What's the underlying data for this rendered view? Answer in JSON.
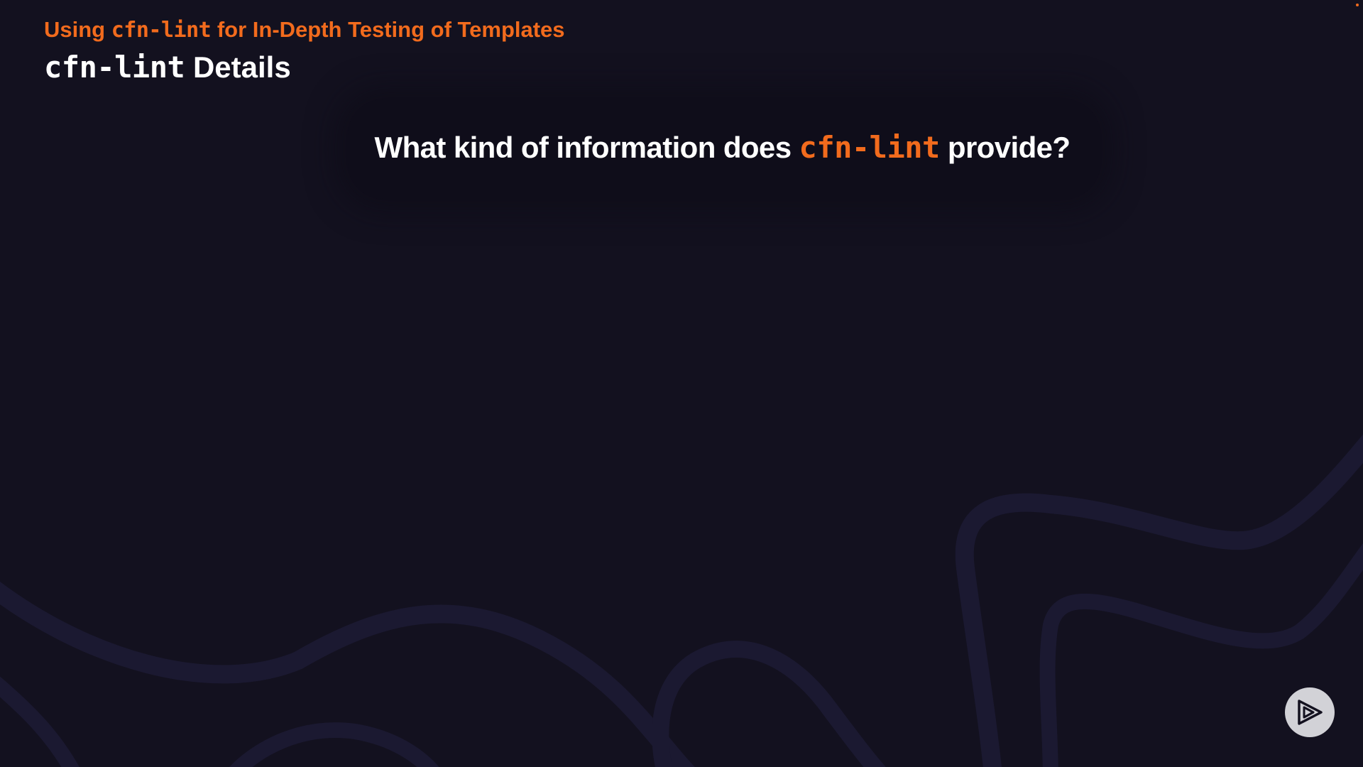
{
  "header": {
    "section_title_prefix": "Using ",
    "section_title_code": "cfn-lint",
    "section_title_suffix": " for In-Depth Testing of Templates",
    "heading_code": "cfn-lint",
    "heading_suffix": " Details"
  },
  "main": {
    "question_prefix": "What kind of information does ",
    "question_code": "cfn-lint",
    "question_suffix": " provide?"
  },
  "logo": {
    "icon": "play-logo-icon"
  },
  "colors": {
    "background": "#13111f",
    "accent": "#f26b1d",
    "text": "#ffffff",
    "wave": "#1b1931",
    "logo_circle": "#d2d2d7",
    "logo_glyph": "#13111f"
  }
}
